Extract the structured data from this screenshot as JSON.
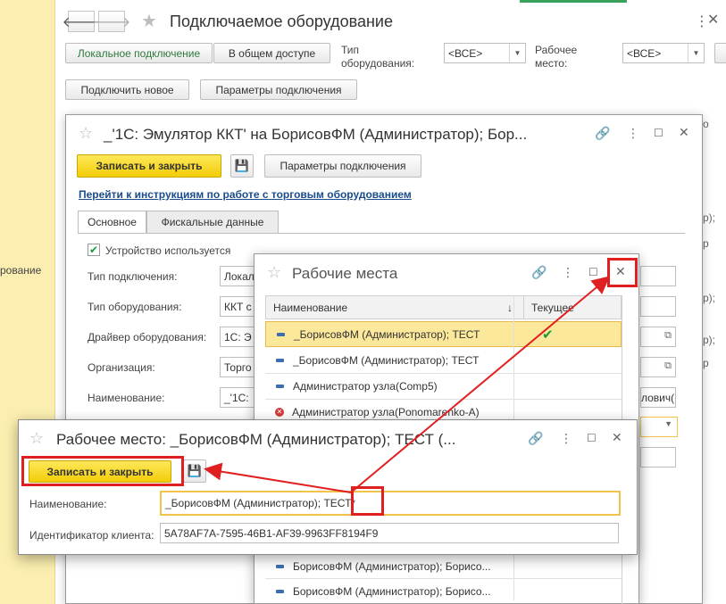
{
  "sidebar": {
    "stub_label": "рование"
  },
  "main": {
    "title": "Подключаемое оборудование",
    "filter": {
      "local_btn": "Локальное подключение",
      "shared_btn": "В общем доступе",
      "type_label": "Тип\nоборудования:",
      "type_value": "<ВСЕ>",
      "workplace_label": "Рабочее\nместо:",
      "workplace_value": "<ВСЕ>"
    },
    "connect_new_btn": "Подключить новое",
    "params_btn": "Параметры подключения",
    "bg_fragments": [
      "о",
      "р);",
      "р",
      "р);",
      "р);",
      "р"
    ]
  },
  "win1": {
    "title": "_'1С: Эмулятор ККТ' на БорисовФМ (Администратор); Бор...",
    "save_close_btn": "Записать и закрыть",
    "params_btn": "Параметры подключения",
    "instr_link": "Перейти к инструкциям по работе с торговым оборудованием",
    "tabs": [
      "Основное",
      "Фискальные данные"
    ],
    "device_used_label": "Устройство используется",
    "fields": [
      {
        "label": "Тип подключения:",
        "value": "Локал"
      },
      {
        "label": "Тип оборудования:",
        "value": "ККТ с"
      },
      {
        "label": "Драйвер оборудования:",
        "value": "1С: Э"
      },
      {
        "label": "Организация:",
        "value": "Торго"
      },
      {
        "label": "Наименование:",
        "value": "_'1С:"
      }
    ],
    "name_field_right": "лович("
  },
  "win2": {
    "title": "Рабочие места",
    "col_name": "Наименование",
    "col_current": "Текущее",
    "rows": [
      {
        "name": "_БорисовФМ (Администратор); ТЕСТ",
        "current": "✔",
        "selected": true
      },
      {
        "name": "_БорисовФМ (Администратор); ТЕСТ",
        "current": ""
      },
      {
        "name": "Администратор узла(Comp5)",
        "current": ""
      },
      {
        "name": "Администратор узла(Ponomarenko-A)",
        "current": "",
        "deleted": true
      }
    ],
    "bottom_rows": [
      {
        "name": "БорисовФМ (Администратор); Борисо..."
      },
      {
        "name": "БорисовФМ (Администратор); Борисо..."
      }
    ]
  },
  "win3": {
    "title": "Рабочее место: _БорисовФМ (Администратор); ТЕСТ (...",
    "save_close_btn": "Записать и закрыть",
    "name_label": "Наименование:",
    "name_value": "_БорисовФМ (Администратор); ТЕСТ*",
    "client_id_label": "Идентификатор клиента:",
    "client_id_value": "5A78AF7A-7595-46B1-AF39-9963FF8194F9"
  },
  "colors": {
    "sidebar_bg": "#fbeeb0",
    "button_yellow": "#f3cd07",
    "highlight_red": "#e02020",
    "link_blue": "#1a4c8b",
    "selected_row": "#fbe89a",
    "check_green": "#1e9a3a"
  },
  "icons": [
    "star-icon",
    "link-icon",
    "more-icon",
    "maximize-icon",
    "close-icon",
    "save-disk-icon",
    "sort-down-icon",
    "checkmark-icon",
    "row-item-icon",
    "deleted-mark-icon",
    "open-link-icon",
    "chevron-down-icon",
    "back-arrow-icon",
    "forward-arrow-icon"
  ]
}
